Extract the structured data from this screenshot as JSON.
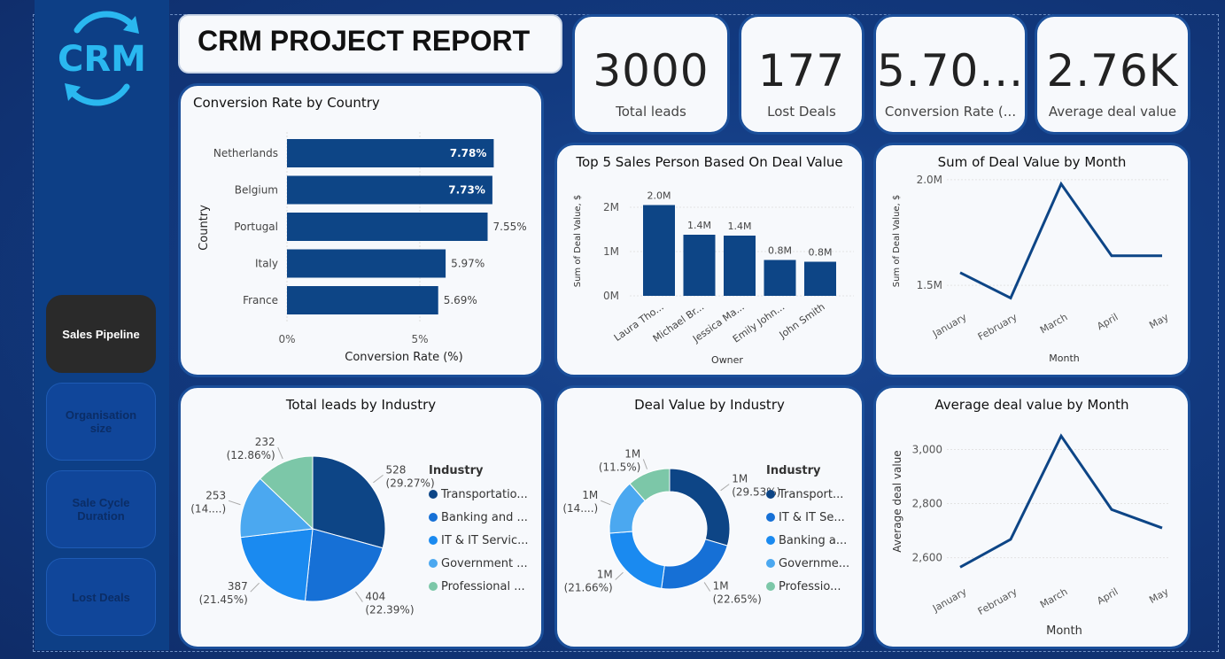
{
  "title": "CRM PROJECT REPORT",
  "logo_text": "CRM",
  "nav": [
    {
      "label": "Sales Pipeline",
      "active": true
    },
    {
      "label": "Organisation size",
      "active": false
    },
    {
      "label": "Sale Cycle Duration",
      "active": false
    },
    {
      "label": "Lost Deals",
      "active": false
    }
  ],
  "kpis": [
    {
      "value": "3000",
      "label": "Total leads"
    },
    {
      "value": "177",
      "label": "Lost Deals"
    },
    {
      "value": "5.70...",
      "label": "Conversion Rate (..."
    },
    {
      "value": "2.76K",
      "label": "Average deal value"
    }
  ],
  "colors": {
    "primary": "#0d4586",
    "blue2": "#1670d6",
    "blue3": "#1a8af0",
    "blue4": "#4ba8f0",
    "green": "#7cc7a8"
  },
  "chart_data": [
    {
      "id": "conversion_by_country",
      "type": "bar",
      "orientation": "horizontal",
      "title": "Conversion Rate by Country",
      "xlabel": "Conversion Rate (%)",
      "ylabel": "Country",
      "categories": [
        "Netherlands",
        "Belgium",
        "Portugal",
        "Italy",
        "France"
      ],
      "values": [
        7.78,
        7.73,
        7.55,
        5.97,
        5.69
      ],
      "data_labels": [
        "7.78%",
        "7.73%",
        "7.55%",
        "5.97%",
        "5.69%"
      ],
      "xticks": [
        "0%",
        "5%"
      ],
      "xlim": [
        0,
        8.5
      ]
    },
    {
      "id": "top5_sales_person",
      "type": "bar",
      "title": "Top 5 Sales Person Based On Deal Value",
      "xlabel": "Owner",
      "ylabel": "Sum of Deal Value, $",
      "categories": [
        "Laura Tho...",
        "Michael Br...",
        "Jessica Ma...",
        "Emily John...",
        "John Smith"
      ],
      "values": [
        2.05,
        1.38,
        1.36,
        0.81,
        0.77
      ],
      "data_labels": [
        "2.0M",
        "1.4M",
        "1.4M",
        "0.8M",
        "0.8M"
      ],
      "yticks": [
        "0M",
        "1M",
        "2M"
      ],
      "ylim": [
        0,
        2.4
      ]
    },
    {
      "id": "deal_value_by_month",
      "type": "line",
      "title": "Sum of Deal Value by Month",
      "xlabel": "Month",
      "ylabel": "Sum of Deal Value, $",
      "categories": [
        "January",
        "February",
        "March",
        "April",
        "May"
      ],
      "values": [
        1.56,
        1.44,
        1.98,
        1.64,
        1.64
      ],
      "yticks": [
        "1.5M",
        "2.0M"
      ],
      "ylim": [
        1.4,
        2.05
      ]
    },
    {
      "id": "leads_by_industry",
      "type": "pie",
      "title": "Total leads by Industry",
      "legend_title": "Industry",
      "labels": [
        "Transportatio...",
        "Banking and ...",
        "IT & IT Servic...",
        "Government ...",
        "Professional ..."
      ],
      "values": [
        528,
        404,
        387,
        253,
        232
      ],
      "slice_labels": [
        [
          "528",
          "(29.27%)"
        ],
        [
          "404",
          "(22.39%)"
        ],
        [
          "387",
          "(21.45%)"
        ],
        [
          "253",
          "(14....)"
        ],
        [
          "232",
          "(12.86%)"
        ]
      ]
    },
    {
      "id": "deal_value_by_industry",
      "type": "pie",
      "donut": true,
      "title": "Deal Value by Industry",
      "legend_title": "Industry",
      "labels": [
        "Transport...",
        "IT & IT Se...",
        "Banking a...",
        "Governme...",
        "Professio..."
      ],
      "values": [
        29.53,
        22.65,
        21.66,
        14.66,
        11.5
      ],
      "slice_labels": [
        [
          "1M",
          "(29.53%)"
        ],
        [
          "1M",
          "(22.65%)"
        ],
        [
          "1M",
          "(21.66%)"
        ],
        [
          "1M",
          "(14....)"
        ],
        [
          "1M",
          "(11.5%)"
        ]
      ]
    },
    {
      "id": "avg_deal_value_by_month",
      "type": "line",
      "title": "Average deal value by Month",
      "xlabel": "Month",
      "ylabel": "Average deal value",
      "categories": [
        "January",
        "February",
        "March",
        "April",
        "May"
      ],
      "values": [
        2565,
        2668,
        3050,
        2778,
        2710
      ],
      "yticks": [
        "2,600",
        "2,800",
        "3,000"
      ],
      "ylim": [
        2540,
        3080
      ]
    }
  ]
}
